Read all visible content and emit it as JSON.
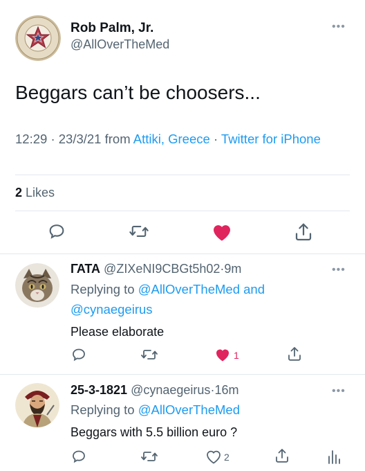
{
  "tweet": {
    "author_name": "Rob Palm, Jr.",
    "author_handle": "@AllOverTheMed",
    "avatar_icon": "bicentennial-star-logo-icon",
    "avatar_ring_text": "AMERICAN REVOLUTION BICENTENNIAL 1776-1976",
    "text": "Beggars can’t be choosers...",
    "time": "12:29",
    "date": "23/3/21",
    "from_label": "from",
    "location": "Attiki, Greece",
    "source": "Twitter for iPhone",
    "dot": "·",
    "likes_count": "2",
    "likes_label": "Likes",
    "liked": true,
    "colors": {
      "accent": "#1d9bf0",
      "like": "#e0245e",
      "muted": "#536471"
    }
  },
  "replies": [
    {
      "name": "ΓΑΤΑ",
      "handle": "@ZIXeNI9CBGt5h02",
      "age": "9m",
      "replying_prefix": "Replying to",
      "replying_to_1": "@AllOverTheMed",
      "and": "and",
      "replying_to_2": "@cynaegeirus",
      "text": "Please elaborate",
      "like_count": "1",
      "liked": true,
      "avatar_icon": "cat-avatar-icon"
    },
    {
      "name": "25-3-1821",
      "handle": "@cynaegeirus",
      "age": "16m",
      "replying_prefix": "Replying to",
      "replying_to_1": "@AllOverTheMed",
      "text": "Beggars with 5.5 billion euro ?",
      "like_count": "2",
      "liked": false,
      "avatar_icon": "greek-revolutionary-portrait-icon"
    }
  ]
}
